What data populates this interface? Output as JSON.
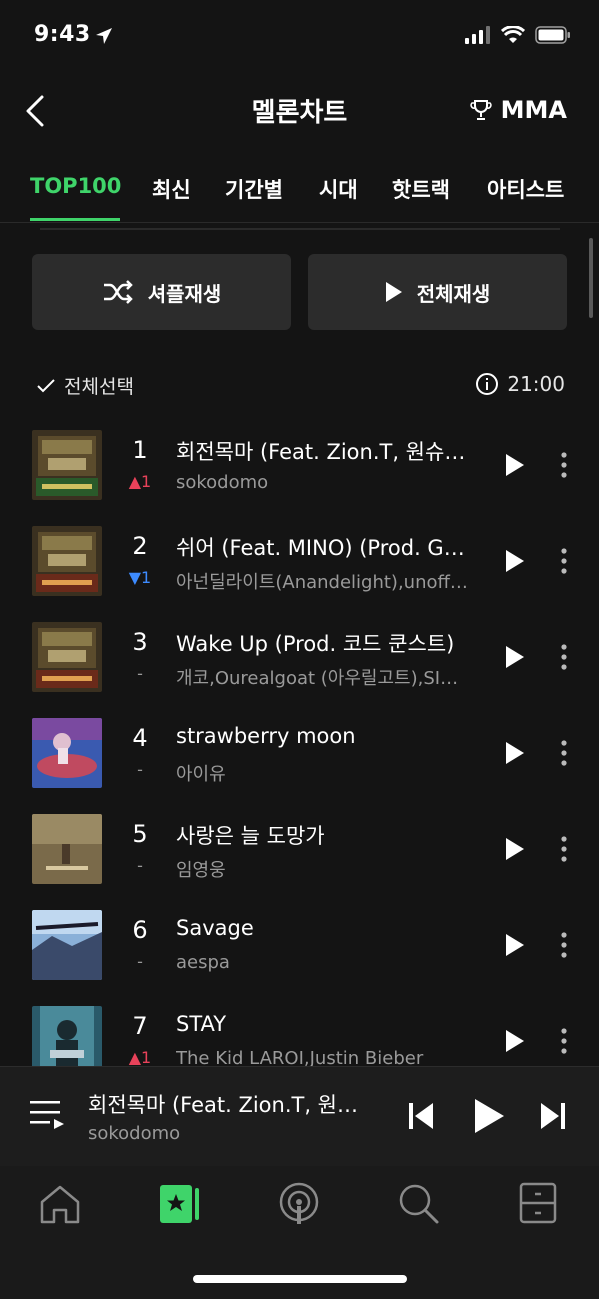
{
  "status": {
    "time": "9:43"
  },
  "header": {
    "title": "멜론차트",
    "mma_label": "MMA"
  },
  "tabs": [
    "TOP100",
    "최신",
    "기간별",
    "시대",
    "핫트랙",
    "아티스트"
  ],
  "actions": {
    "shuffle_label": "셔플재생",
    "play_all_label": "전체재생"
  },
  "list_toolbar": {
    "select_all_label": "전체선택",
    "update_time": "21:00"
  },
  "chart": [
    {
      "rank": "1",
      "change": "▲1",
      "change_dir": "up",
      "title": "회전목마 (Feat. Zion.T, 원슈…",
      "artist": "sokodomo",
      "art": "smtm-ep2"
    },
    {
      "rank": "2",
      "change": "▼1",
      "change_dir": "down",
      "title": "쉬어 (Feat. MINO) (Prod. G…",
      "artist": "아넌딜라이트(Anandelight),unoff…",
      "art": "smtm-ep1"
    },
    {
      "rank": "3",
      "change": "-",
      "change_dir": "same",
      "title": "Wake Up (Prod. 코드 쿤스트)",
      "artist": "개코,Ourealgoat (아우릴고트),SI…",
      "art": "smtm-ep1"
    },
    {
      "rank": "4",
      "change": "-",
      "change_dir": "same",
      "title": "strawberry moon",
      "artist": "아이유",
      "art": "strawberry"
    },
    {
      "rank": "5",
      "change": "-",
      "change_dir": "same",
      "title": "사랑은 늘 도망가",
      "artist": "임영웅",
      "art": "love"
    },
    {
      "rank": "6",
      "change": "-",
      "change_dir": "same",
      "title": "Savage",
      "artist": "aespa",
      "art": "savage"
    },
    {
      "rank": "7",
      "change": "▲1",
      "change_dir": "up",
      "title": "STAY",
      "artist": "The Kid LAROI,Justin Bieber",
      "art": "stay"
    }
  ],
  "now_playing": {
    "title": "회전목마 (Feat. Zion.T, 원…",
    "artist": "sokodomo"
  },
  "colors": {
    "accent": "#3fd46a",
    "up": "#e8425a",
    "down": "#3d8bff",
    "background": "#141414"
  },
  "nav_icons": [
    "home-icon",
    "melon-chart-icon",
    "podcast-icon",
    "search-icon",
    "library-icon"
  ]
}
